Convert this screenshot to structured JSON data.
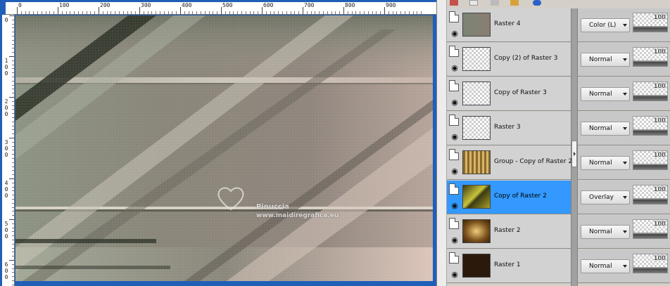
{
  "ruler": {
    "top_labels": [
      "0",
      "100",
      "200",
      "300",
      "400",
      "500",
      "600",
      "700",
      "800",
      "900"
    ],
    "left_labels": [
      "0",
      "1\n0\n0",
      "2\n0\n0",
      "3\n0\n0",
      "4\n0\n0",
      "5\n0\n0",
      "6\n0\n0"
    ]
  },
  "watermark": {
    "title": "Pinuccia",
    "url": "www.maidiregrafica.eu"
  },
  "layers": [
    {
      "name": "Raster 4",
      "blend_mode": "Color (L)",
      "opacity": "100",
      "selected": false,
      "thumb": "raster4"
    },
    {
      "name": "Copy (2) of Raster 3",
      "blend_mode": "Normal",
      "opacity": "100",
      "selected": false,
      "thumb": "copy2r3"
    },
    {
      "name": "Copy of Raster 3",
      "blend_mode": "Normal",
      "opacity": "100",
      "selected": false,
      "thumb": "copyr3"
    },
    {
      "name": "Raster 3",
      "blend_mode": "Normal",
      "opacity": "100",
      "selected": false,
      "thumb": "raster3"
    },
    {
      "name": "Group - Copy of Raster 2",
      "blend_mode": "Normal",
      "opacity": "100",
      "selected": false,
      "thumb": "group"
    },
    {
      "name": "Copy of Raster 2",
      "blend_mode": "Overlay",
      "opacity": "100",
      "selected": true,
      "thumb": "copyr2"
    },
    {
      "name": "Raster 2",
      "blend_mode": "Normal",
      "opacity": "100",
      "selected": false,
      "thumb": "raster2"
    },
    {
      "name": "Raster 1",
      "blend_mode": "Normal",
      "opacity": "100",
      "selected": false,
      "thumb": "raster1"
    }
  ],
  "colors": {
    "selected_row": "#3399ff",
    "canvas_bg": "#8e897f",
    "workspace": "#1f5fb8"
  },
  "icons": {
    "visibility": "eye-icon",
    "layer_type": "raster-layer-icon",
    "dropdown": "chevron-down-icon"
  }
}
